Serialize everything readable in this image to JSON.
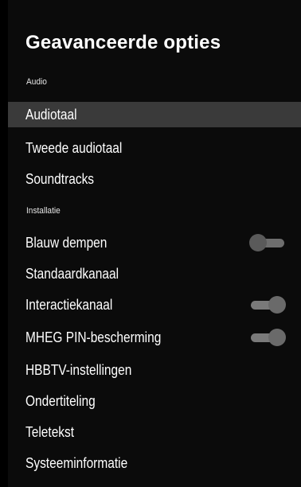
{
  "title": "Geavanceerde opties",
  "sections": {
    "audio": "Audio",
    "installatie": "Installatie"
  },
  "items": [
    {
      "label": "Audiotaal",
      "selected": true
    },
    {
      "label": "Tweede audiotaal"
    },
    {
      "label": "Soundtracks"
    },
    {
      "label": "Blauw dempen",
      "toggle": "off"
    },
    {
      "label": "Standaardkanaal"
    },
    {
      "label": "Interactiekanaal",
      "toggle": "on"
    },
    {
      "label": "MHEG PIN-bescherming",
      "toggle": "on"
    },
    {
      "label": "HBBTV-instellingen"
    },
    {
      "label": "Ondertiteling"
    },
    {
      "label": "Teletekst"
    },
    {
      "label": "Systeeminformatie"
    }
  ],
  "colors": {
    "background": "#000000",
    "panel": "#0b0b0b",
    "selected_row": "#3a3a3a",
    "text": "#ffffff"
  }
}
